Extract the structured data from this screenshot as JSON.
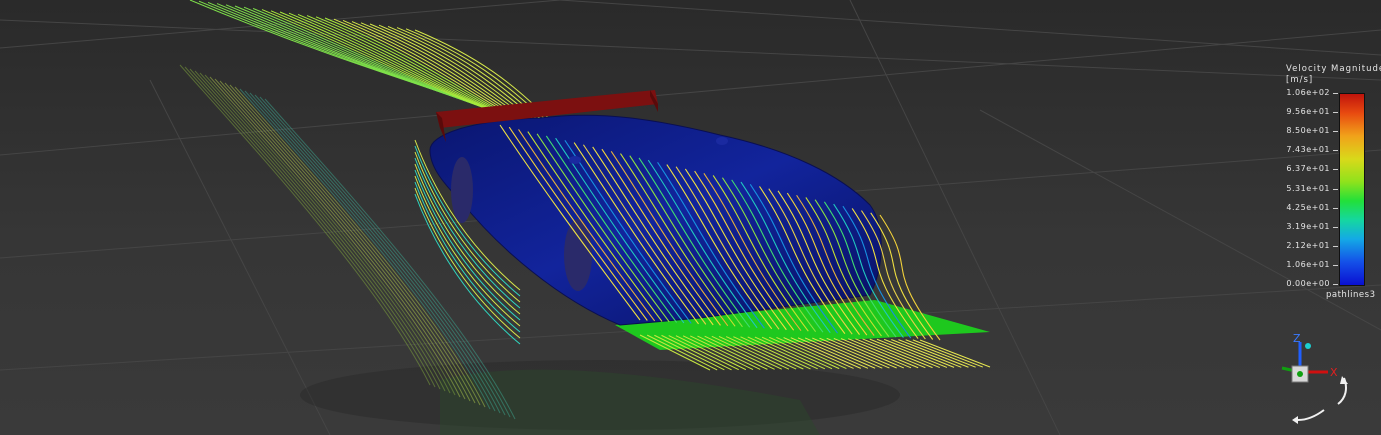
{
  "legend": {
    "title": "Velocity Magnitude",
    "unit": "[m/s]",
    "ticks": [
      "1.06e+02",
      "9.56e+01",
      "8.50e+01",
      "7.43e+01",
      "6.37e+01",
      "5.31e+01",
      "4.25e+01",
      "3.19e+01",
      "2.12e+01",
      "1.06e+01",
      "0.00e+00"
    ],
    "name": "pathlines3",
    "colormap": [
      "#c0140c",
      "#e84a10",
      "#f1a21a",
      "#d9d91a",
      "#8fe21c",
      "#22e03a",
      "#15d7a0",
      "#14a9e6",
      "#1450e8",
      "#0a10d2"
    ]
  },
  "triad": {
    "z_label": "Z",
    "x_label": "X"
  },
  "scene": {
    "background": "#2f2f2f",
    "body_color": "#0e1e8c",
    "wing_color": "#7c1010",
    "floor_color": "#1ec81e"
  }
}
